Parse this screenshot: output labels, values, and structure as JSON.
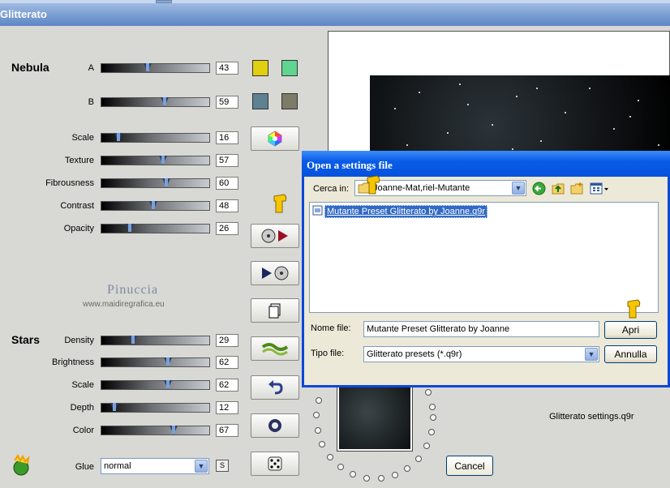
{
  "app": {
    "title": "Glitterato"
  },
  "nebula": {
    "heading": "Nebula",
    "sliders": [
      {
        "label": "A",
        "value": "43",
        "frac": 0.43
      },
      {
        "label": "B",
        "value": "59",
        "frac": 0.59
      },
      {
        "label": "Scale",
        "value": "16",
        "frac": 0.16
      },
      {
        "label": "Texture",
        "value": "57",
        "frac": 0.57
      },
      {
        "label": "Fibrousness",
        "value": "60",
        "frac": 0.6
      },
      {
        "label": "Contrast",
        "value": "48",
        "frac": 0.48
      },
      {
        "label": "Opacity",
        "value": "26",
        "frac": 0.26
      }
    ],
    "colors": {
      "a1": "#e0d010",
      "a2": "#5fd590",
      "b1": "#5f8292",
      "b2": "#7c7c68"
    }
  },
  "stars": {
    "heading": "Stars",
    "sliders": [
      {
        "label": "Density",
        "value": "29",
        "frac": 0.29
      },
      {
        "label": "Brightness",
        "value": "62",
        "frac": 0.62
      },
      {
        "label": "Scale",
        "value": "62",
        "frac": 0.62
      },
      {
        "label": "Depth",
        "value": "12",
        "frac": 0.12
      },
      {
        "label": "Color",
        "value": "67",
        "frac": 0.67
      }
    ]
  },
  "glue": {
    "label": "Glue",
    "value": "normal",
    "small_btn": "S"
  },
  "watermark": {
    "name": "Pinuccia",
    "url": "www.maidiregrafica.eu"
  },
  "dialog": {
    "title": "Open a settings file",
    "look_in_label": "Cerca in:",
    "look_in_value": "Joanne-Mat,riel-Mutante",
    "file_item": "Mutante Preset Glitterato by Joanne.q9r",
    "filename_label": "Nome file:",
    "filename_value": "Mutante Preset Glitterato by Joanne",
    "filetype_label": "Tipo file:",
    "filetype_value": "Glitterato presets (*.q9r)",
    "open_button": "Apri",
    "cancel_button": "Annulla"
  },
  "bottom": {
    "settings_label": "Glitterato settings.q9r",
    "cancel_label": "Cancel"
  },
  "icons": [
    "color-wheel-icon",
    "load-preset-icon",
    "save-preset-icon",
    "copy-icon",
    "wave-icon",
    "undo-icon",
    "ring-icon",
    "dice-icon",
    "back-icon",
    "up-folder-icon",
    "new-folder-icon",
    "view-menu-icon",
    "folder-icon",
    "file-icon",
    "hand-cursor-icon",
    "app-logo-icon"
  ]
}
